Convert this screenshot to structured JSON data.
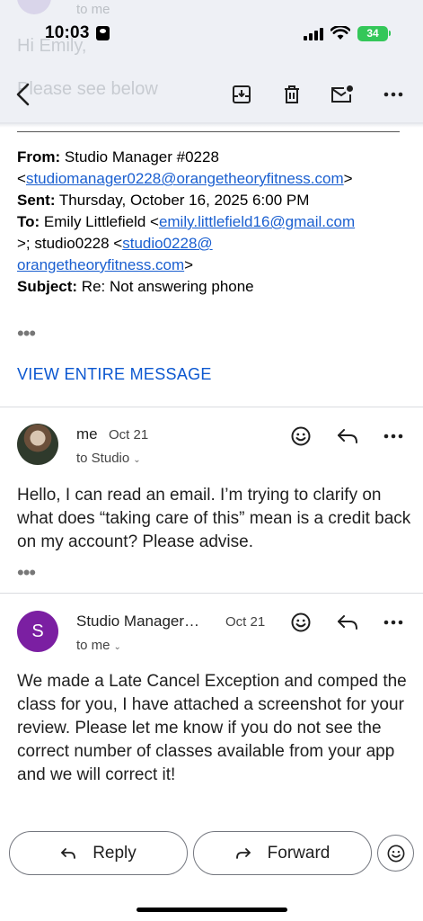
{
  "status_bar": {
    "time": "10:03",
    "battery": "34"
  },
  "behind": {
    "to_text": "to me",
    "greeting": "Hi Emily,",
    "preview": "Please see below"
  },
  "toolbar": {
    "back": "back-arrow-icon",
    "archive": "archive-icon",
    "delete": "trash-icon",
    "mark_unread": "mail-unread-icon",
    "more": "more-vert-icon"
  },
  "quoted": {
    "from_label": "From:",
    "from_name": "Studio Manager #0228",
    "from_email": "studiomanager0228@orangetheoryfitness.com",
    "sent_label": "Sent:",
    "sent_value": "Thursday, October 16, 2025 6:00 PM",
    "to_label": "To:",
    "to_name": "Emily Littlefield",
    "to_email": "emily.littlefield16@gmail.com",
    "to_cont": ">; studio0228 <",
    "to_email2_a": "studio0228@",
    "to_email2_b": "orangetheoryfitness.com",
    "subject_label": "Subject:",
    "subject_value": "Re: Not answering phone"
  },
  "view_entire": "VIEW ENTIRE MESSAGE",
  "messages": [
    {
      "sender": "me",
      "date": "Oct 21",
      "recipients": "to Studio",
      "body": "Hello, I can read an email. I’m trying to clarify on what does “taking care of this” mean is a credit back on my account? Please advise."
    },
    {
      "avatar_letter": "S",
      "sender": "Studio Manager…",
      "date": "Oct 21",
      "recipients": "to me",
      "body": "We made a Late Cancel Exception and comped the class for you, I have attached a screenshot for your review. Please let me know if you do not see the correct number of classes available from your app and we will correct it!"
    }
  ],
  "actions": {
    "reply": "Reply",
    "forward": "Forward"
  },
  "colors": {
    "link": "#1a5fd0",
    "accent": "#0b57d0",
    "avatar_s": "#7b1fa2",
    "battery": "#34c759"
  }
}
